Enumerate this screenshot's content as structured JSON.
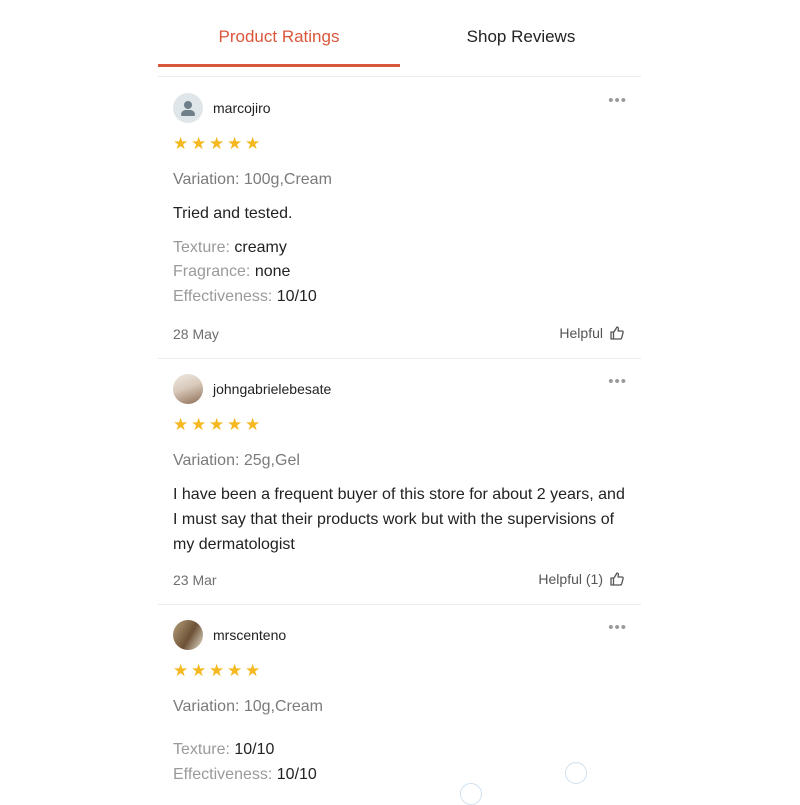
{
  "tabs": [
    {
      "label": "Product Ratings",
      "active": true
    },
    {
      "label": "Shop Reviews",
      "active": false
    }
  ],
  "accent_color": "#d9573a",
  "star_color": "#f5b820",
  "reviews": [
    {
      "username": "marcojiro",
      "avatar": "default-user-icon",
      "rating": 5,
      "variation": "Variation: 100g,Cream",
      "text": "Tried and tested.",
      "attributes": [
        {
          "key": "Texture:",
          "value": "creamy"
        },
        {
          "key": "Fragrance:",
          "value": "none"
        },
        {
          "key": "Effectiveness:",
          "value": "10/10"
        }
      ],
      "date": "28 May",
      "helpful": "Helpful"
    },
    {
      "username": "johngabrielebesate",
      "avatar": "user-photo",
      "rating": 5,
      "variation": "Variation: 25g,Gel",
      "text": "I have been a frequent buyer of this store for about 2 years, and I must say that their products work but with the supervisions of my dermatologist",
      "attributes": [],
      "date": "23 Mar",
      "helpful": "Helpful (1)"
    },
    {
      "username": "mrscenteno",
      "avatar": "user-photo",
      "rating": 5,
      "variation": "Variation: 10g,Cream",
      "text": "",
      "attributes": [
        {
          "key": "Texture:",
          "value": "10/10"
        },
        {
          "key": "Effectiveness:",
          "value": "10/10"
        }
      ]
    }
  ],
  "more_icon": "•••",
  "star_icon": "★"
}
